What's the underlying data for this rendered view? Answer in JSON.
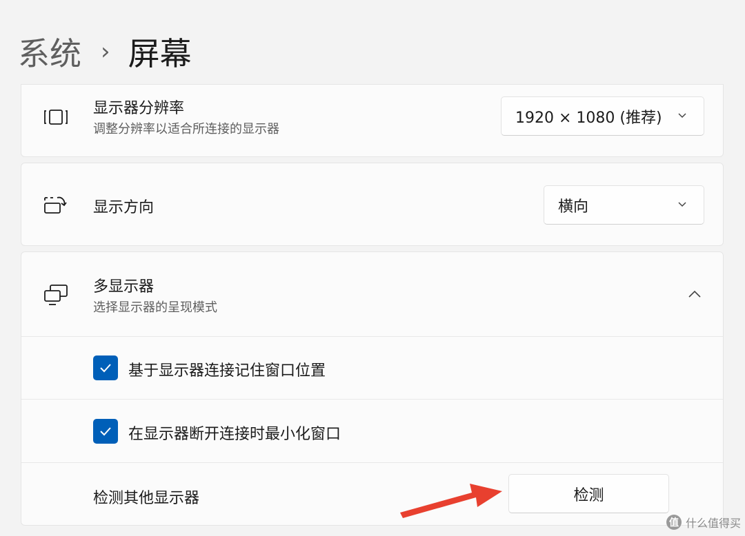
{
  "breadcrumb": {
    "parent": "系统",
    "separator": "›",
    "current": "屏幕"
  },
  "resolution": {
    "icon": "display-resolution-icon",
    "title": "显示器分辨率",
    "description": "调整分辨率以适合所连接的显示器",
    "value": "1920 × 1080 (推荐)"
  },
  "orientation": {
    "icon": "display-orientation-icon",
    "title": "显示方向",
    "value": "横向"
  },
  "multi_display": {
    "icon": "multiple-displays-icon",
    "title": "多显示器",
    "description": "选择显示器的呈现模式",
    "expanded": true,
    "options": [
      {
        "label": "基于显示器连接记住窗口位置",
        "checked": true
      },
      {
        "label": "在显示器断开连接时最小化窗口",
        "checked": true
      }
    ],
    "detect": {
      "label": "检测其他显示器",
      "button": "检测"
    }
  },
  "watermark": {
    "text": "什么值得买",
    "logo": "值"
  },
  "colors": {
    "accent": "#005fb8",
    "annotation_arrow": "#e8402f",
    "background": "#f3f3f3",
    "card": "#fbfbfb"
  }
}
